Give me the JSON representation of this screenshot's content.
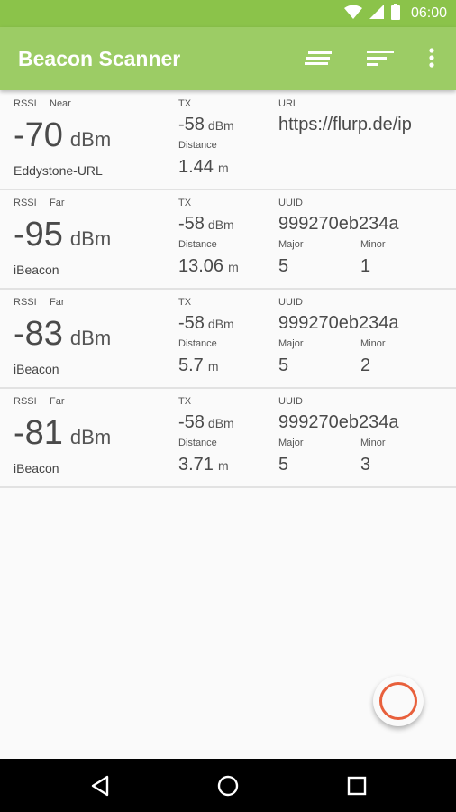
{
  "status_bar": {
    "time": "06:00"
  },
  "app_bar": {
    "title": "Beacon Scanner"
  },
  "labels": {
    "rssi": "RSSI",
    "tx": "TX",
    "distance": "Distance",
    "url": "URL",
    "uuid": "UUID",
    "major": "Major",
    "minor": "Minor",
    "dbm": "dBm",
    "m": "m"
  },
  "beacons": [
    {
      "proximity": "Near",
      "rssi": "-70",
      "type": "Eddystone-URL",
      "tx": "-58",
      "distance": "1.44",
      "url": "https://flurp.de/ip"
    },
    {
      "proximity": "Far",
      "rssi": "-95",
      "type": "iBeacon",
      "tx": "-58",
      "distance": "13.06",
      "uuid": "999270eb234a",
      "major": "5",
      "minor": "1"
    },
    {
      "proximity": "Far",
      "rssi": "-83",
      "type": "iBeacon",
      "tx": "-58",
      "distance": "5.7",
      "uuid": "999270eb234a",
      "major": "5",
      "minor": "2"
    },
    {
      "proximity": "Far",
      "rssi": "-81",
      "type": "iBeacon",
      "tx": "-58",
      "distance": "3.71",
      "uuid": "999270eb234a",
      "major": "5",
      "minor": "3"
    }
  ],
  "colors": {
    "app_bar": "#9ccc65",
    "status_bar": "#8bc34a",
    "fab_ring": "#e8603c"
  },
  "icons": [
    "wifi-icon",
    "signal-icon",
    "battery-icon",
    "sort-icon",
    "filter-icon",
    "more-vert-icon",
    "back-icon",
    "home-icon",
    "recents-icon"
  ]
}
